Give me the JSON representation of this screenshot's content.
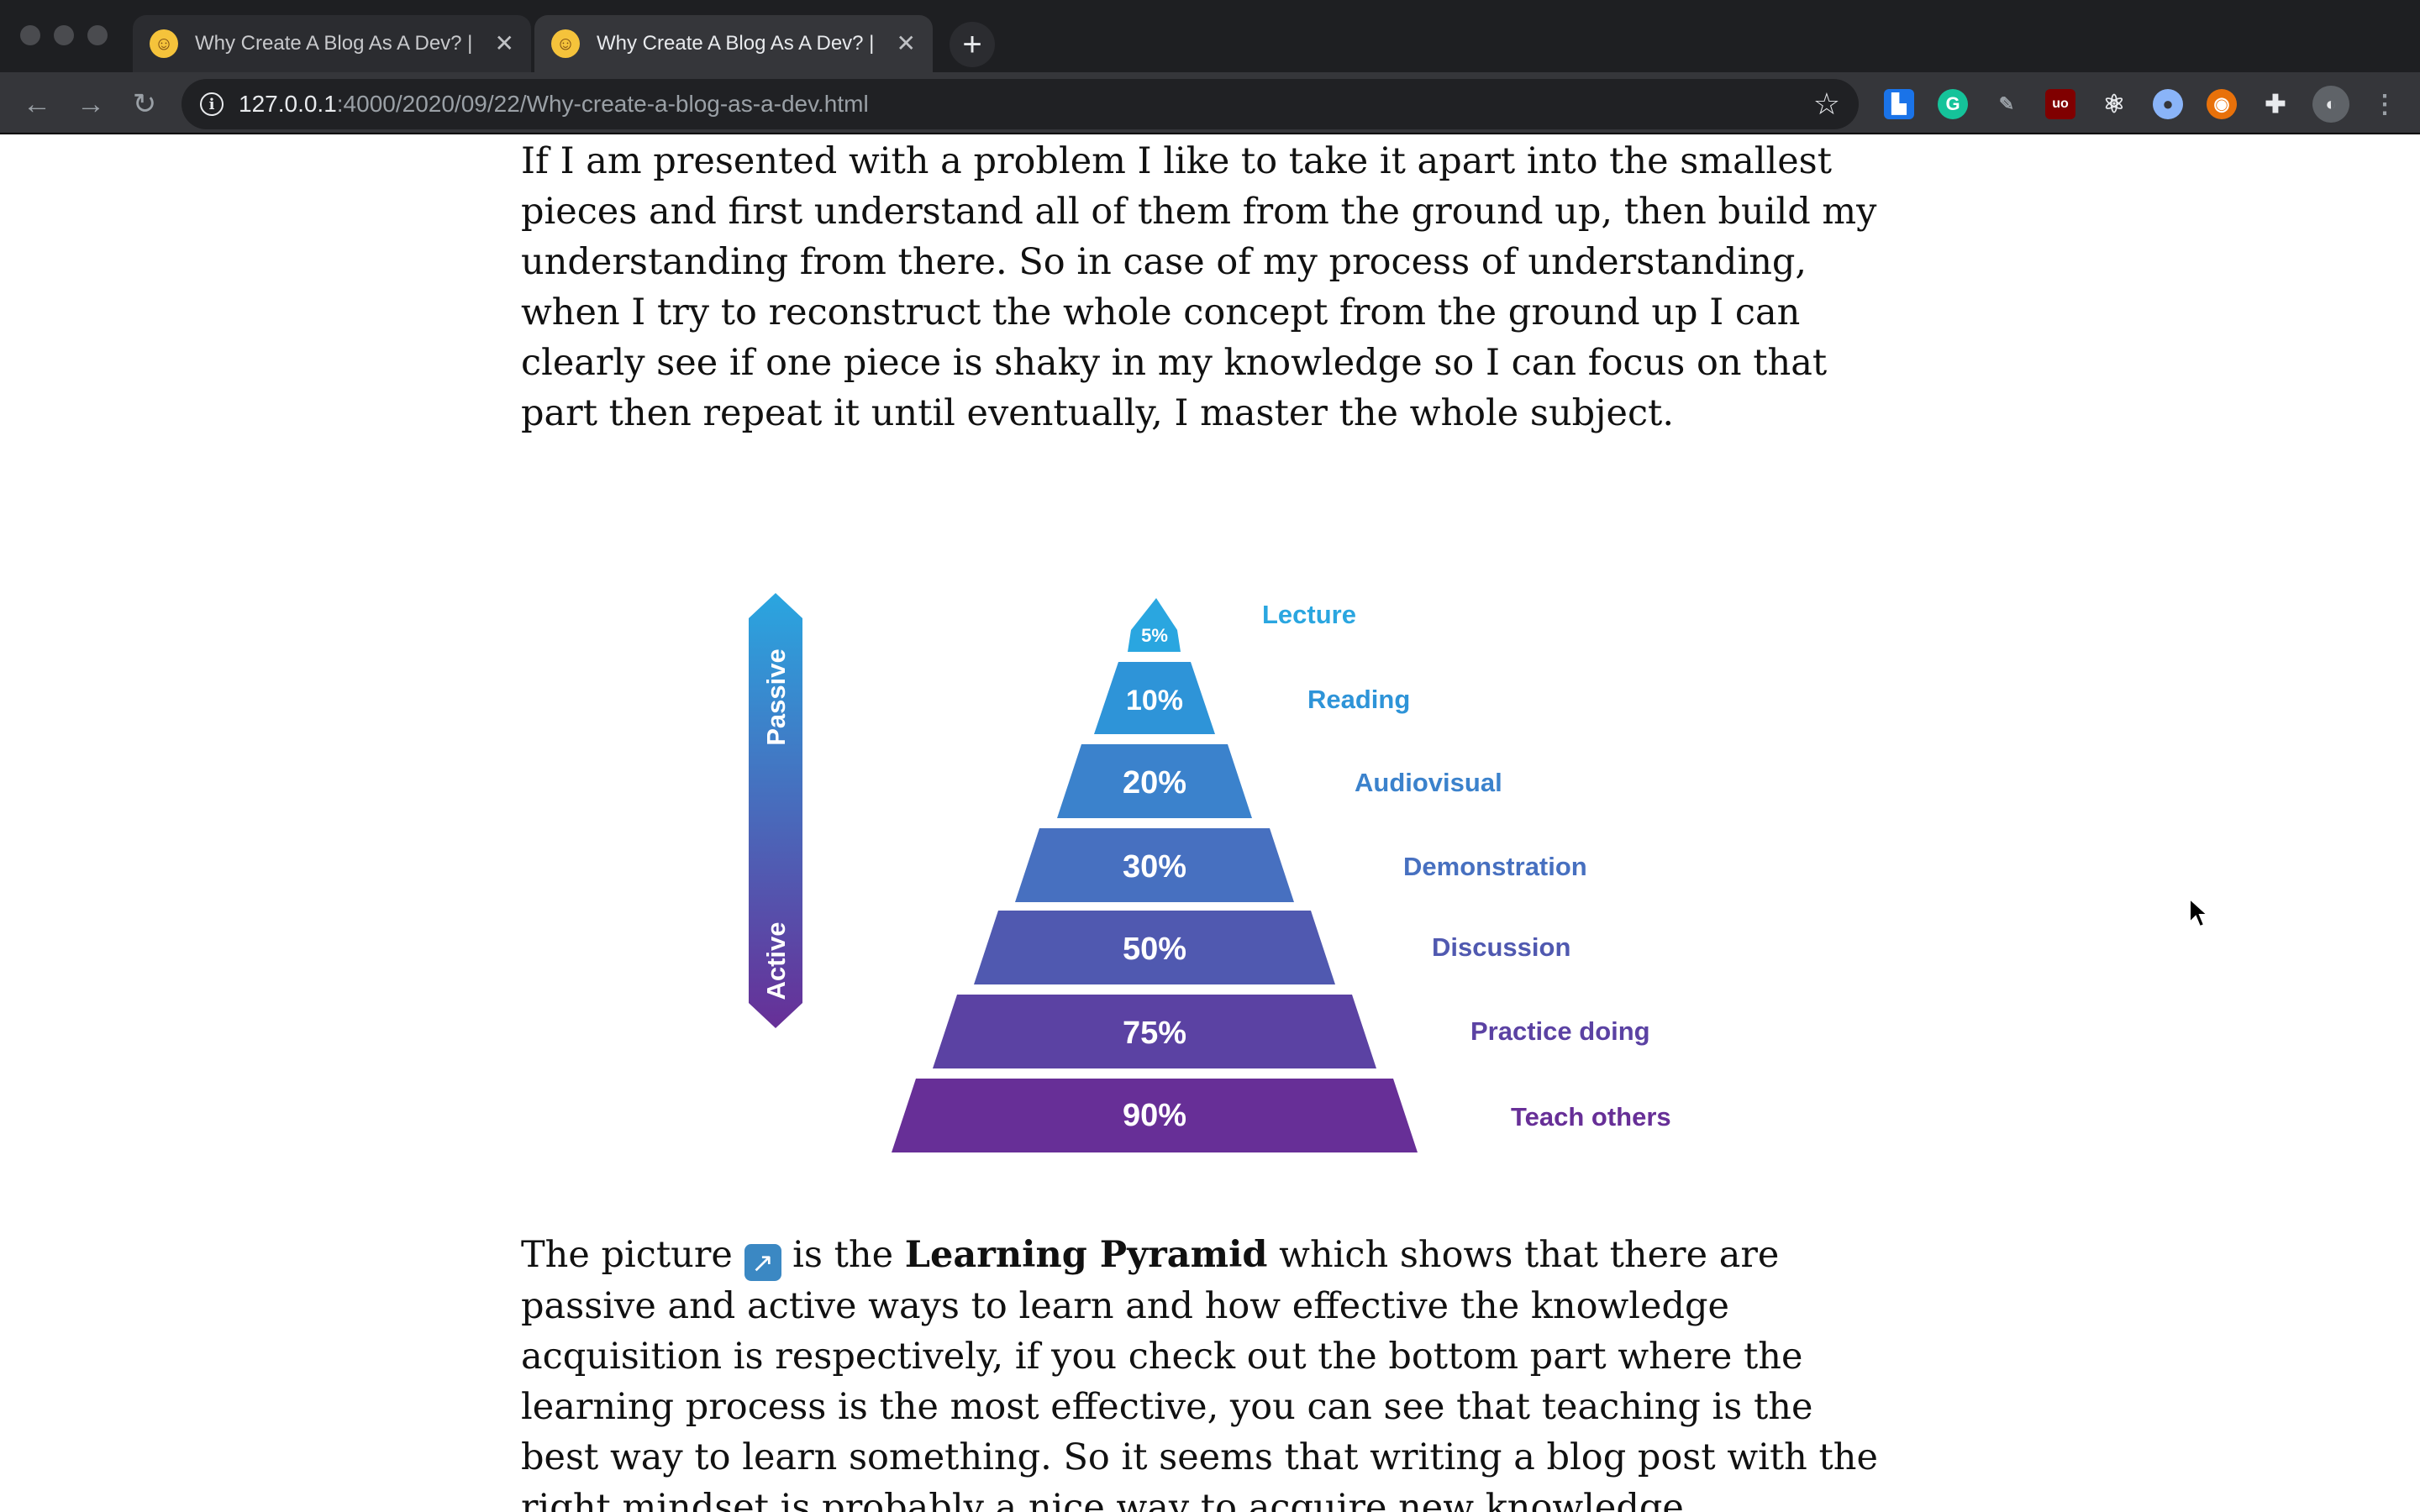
{
  "browser": {
    "tabs": [
      {
        "title": "Why Create A Blog As A Dev? |",
        "favicon": "cowboy-emoji-icon",
        "active": false
      },
      {
        "title": "Why Create A Blog As A Dev? |",
        "favicon": "cowboy-emoji-icon",
        "active": true
      }
    ],
    "url_host": "127.0.0.1",
    "url_path": ":4000/2020/09/22/Why-create-a-blog-as-a-dev.html",
    "new_tab_label": "+",
    "close_label": "✕",
    "extensions": [
      "puzzle-extension-icon",
      "grammarly-icon",
      "pen-extension-icon",
      "ublock-icon",
      "react-devtools-icon",
      "circle-extension-icon",
      "fire-extension-icon",
      "extensions-icon",
      "profile-avatar-icon",
      "menu-dots-icon"
    ]
  },
  "article": {
    "para1": "If I am presented with a problem I like to take it apart into the smallest pieces and first understand all of them from the ground up, then build my understanding from there. So in case of my process of understanding, when I try to reconstruct the whole concept from the ground up I can clearly see if one piece is shaky in my knowledge so I can focus on that part then repeat it until eventually, I master the whole subject.",
    "para2_before": "The picture ",
    "para2_emoji": "↗",
    "para2_mid": " is the ",
    "para2_bold": "Learning Pyramid",
    "para2_after": " which shows that there are passive and active ways to learn and how effective the knowledge acquisition is respectively, if you check out the bottom part where the learning process is the most effective, you can see that teaching is the best way to learn something. So it seems that writing a blog post with the right mindset is probably a nice way to acquire new knowledge."
  },
  "pyramid": {
    "passive_label": "Passive",
    "active_label": "Active",
    "levels": [
      {
        "percent": "5%",
        "label": "Lecture",
        "color": "#2aa6e0",
        "label_color": "#2aa6e0"
      },
      {
        "percent": "10%",
        "label": "Reading",
        "color": "#2e94d8",
        "label_color": "#2e94d8"
      },
      {
        "percent": "20%",
        "label": "Audiovisual",
        "color": "#3b82cc",
        "label_color": "#3b82cc"
      },
      {
        "percent": "30%",
        "label": "Demonstration",
        "color": "#4770c0",
        "label_color": "#4770c0"
      },
      {
        "percent": "50%",
        "label": "Discussion",
        "color": "#5059b0",
        "label_color": "#5059b0"
      },
      {
        "percent": "75%",
        "label": "Practice doing",
        "color": "#5b42a3",
        "label_color": "#5b42a3"
      },
      {
        "percent": "90%",
        "label": "Teach others",
        "color": "#672f97",
        "label_color": "#672f97"
      }
    ]
  }
}
